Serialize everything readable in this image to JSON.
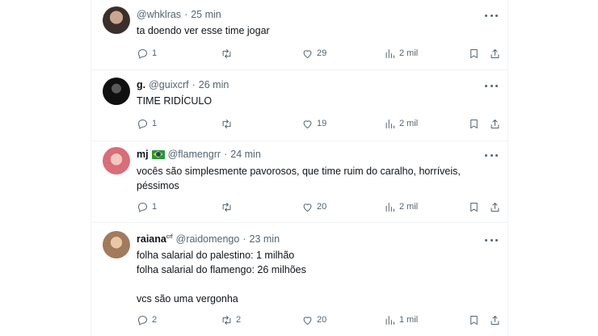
{
  "colors": {
    "text": "#0f1419",
    "muted": "#536471",
    "border": "#eff3f4"
  },
  "tweets": [
    {
      "name": "",
      "handle": "@whklras",
      "dot": "·",
      "time": "25 min",
      "text": "ta doendo ver esse time jogar",
      "replies": "1",
      "retweets": "",
      "likes": "29",
      "views": "2 mil",
      "avatar_color": "#6b5a52"
    },
    {
      "name": "g.",
      "handle": "@guixcrf",
      "dot": "·",
      "time": "26 min",
      "text": "TIME RIDÍCULO",
      "replies": "1",
      "retweets": "",
      "likes": "19",
      "views": "2 mil",
      "avatar_color": "#151515"
    },
    {
      "name": "mj",
      "handle": "@flamengrr",
      "dot": "·",
      "time": "24 min",
      "text": "vocês são simplesmente pavorosos, que time ruim do caralho, horríveis,\npéssimos",
      "replies": "1",
      "retweets": "",
      "likes": "20",
      "views": "2 mil",
      "avatar_color": "#d97a7f",
      "flag": "brazil-flag"
    },
    {
      "name": "raiana",
      "name_sup": "crf",
      "handle": "@raidomengo",
      "dot": "·",
      "time": "23 min",
      "text": "folha salarial do palestino: 1 milhão\nfolha salarial do flamengo: 26 milhões\n\nvcs são uma vergonha",
      "replies": "2",
      "retweets": "2",
      "likes": "20",
      "views": "1 mil",
      "avatar_color": "#c49a7a"
    }
  ],
  "icons": [
    "reply-icon",
    "retweet-icon",
    "like-icon",
    "views-icon",
    "bookmark-icon",
    "share-icon",
    "more-icon"
  ]
}
